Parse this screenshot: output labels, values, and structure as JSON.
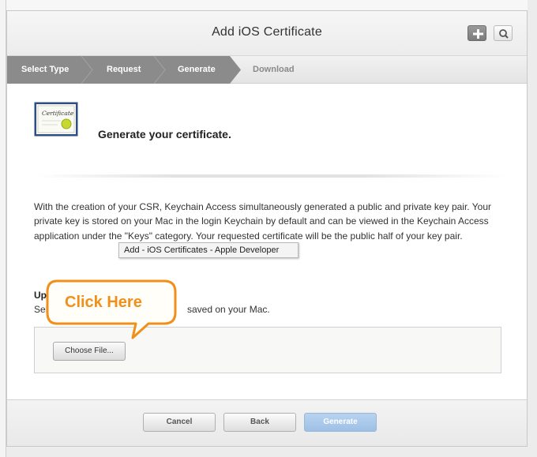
{
  "window": {
    "title": "Add iOS Certificate"
  },
  "toolbar": {
    "add_icon": "plus-icon",
    "search_icon": "search-icon"
  },
  "steps": [
    {
      "label": "Select Type",
      "state": "done"
    },
    {
      "label": "Request",
      "state": "done"
    },
    {
      "label": "Generate",
      "state": "current"
    },
    {
      "label": "Download",
      "state": "pending"
    }
  ],
  "content": {
    "certificate_icon_text": "Certificate",
    "heading": "Generate your certificate.",
    "paragraph": "With the creation of your CSR, Keychain Access simultaneously generated a public and private key pair. Your private key is stored on your Mac in the login Keychain by default and can be viewed in the Keychain Access application under the \"Keys\" category. Your requested certificate will be the public half of your key pair.",
    "upload_title": "Upload CSR file.",
    "upload_desc_visible_start": "Sel",
    "upload_desc_visible_end": "saved on your Mac.",
    "choose_file_label": "Choose File..."
  },
  "tooltip": {
    "text": "Add - iOS Certificates - Apple Developer"
  },
  "callout": {
    "text": "Click Here",
    "color": "#f0901a"
  },
  "footer": {
    "cancel_label": "Cancel",
    "back_label": "Back",
    "generate_label": "Generate"
  },
  "colors": {
    "active_step": "#8d8d8d",
    "primary_button": "#a9c8ea",
    "callout_orange": "#f0901a"
  }
}
